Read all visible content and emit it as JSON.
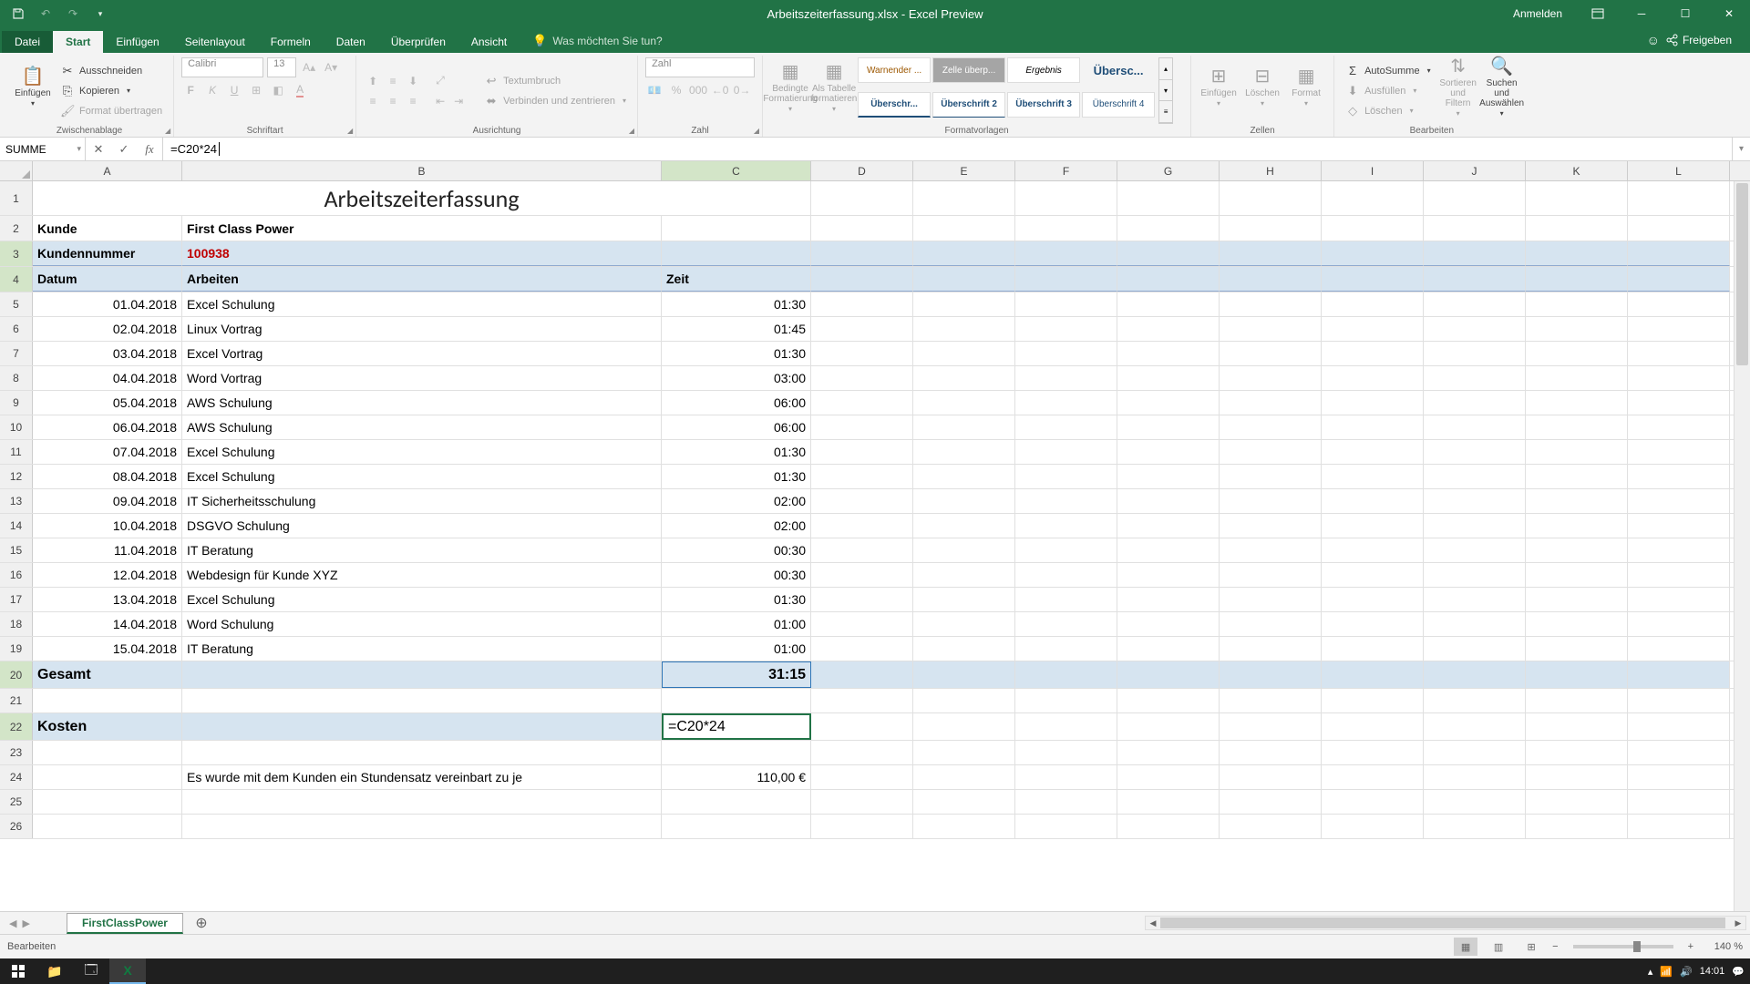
{
  "titlebar": {
    "title": "Arbeitszeiterfassung.xlsx - Excel Preview",
    "signin": "Anmelden"
  },
  "tabs": {
    "file": "Datei",
    "home": "Start",
    "insert": "Einfügen",
    "pagelayout": "Seitenlayout",
    "formulas": "Formeln",
    "data": "Daten",
    "review": "Überprüfen",
    "view": "Ansicht",
    "tellme": "Was möchten Sie tun?",
    "share": "Freigeben"
  },
  "ribbon": {
    "clipboard": {
      "label": "Zwischenablage",
      "paste": "Einfügen",
      "cut": "Ausschneiden",
      "copy": "Kopieren",
      "format_painter": "Format übertragen"
    },
    "font": {
      "label": "Schriftart",
      "name": "Calibri",
      "size": "13"
    },
    "alignment": {
      "label": "Ausrichtung",
      "wrap": "Textumbruch",
      "merge": "Verbinden und zentrieren"
    },
    "number": {
      "label": "Zahl",
      "format": "Zahl"
    },
    "styles": {
      "label": "Formatvorlagen",
      "conditional": "Bedingte Formatierung",
      "as_table": "Als Tabelle formatieren",
      "gallery": [
        "Warnender ...",
        "Zelle überp...",
        "Ergebnis",
        "Übersc...",
        "Überschr...",
        "Überschrift 2",
        "Überschrift 3",
        "Überschrift 4"
      ]
    },
    "cells": {
      "label": "Zellen",
      "insert": "Einfügen",
      "delete": "Löschen",
      "format": "Format"
    },
    "editing": {
      "label": "Bearbeiten",
      "autosum": "AutoSumme",
      "fill": "Ausfüllen",
      "clear": "Löschen",
      "sort": "Sortieren und Filtern",
      "find": "Suchen und Auswählen"
    }
  },
  "formula_bar": {
    "name_box": "SUMME",
    "formula": "=C20*24"
  },
  "columns": [
    "A",
    "B",
    "C",
    "D",
    "E",
    "F",
    "G",
    "H",
    "I",
    "J",
    "K",
    "L"
  ],
  "sheet": {
    "title": "Arbeitszeiterfassung",
    "labels": {
      "kunde": "Kunde",
      "kunde_val": "First Class Power",
      "kundennr": "Kundennummer",
      "kundennr_val": "100938",
      "datum": "Datum",
      "arbeiten": "Arbeiten",
      "zeit": "Zeit",
      "gesamt": "Gesamt",
      "gesamt_val": "31:15",
      "kosten": "Kosten",
      "kosten_formula": "=C20*24",
      "rate_text": "Es wurde mit dem Kunden ein Stundensatz vereinbart zu je",
      "rate_val": "110,00 €"
    },
    "rows": [
      {
        "n": 5,
        "date": "01.04.2018",
        "work": "Excel Schulung",
        "time": "01:30"
      },
      {
        "n": 6,
        "date": "02.04.2018",
        "work": "Linux Vortrag",
        "time": "01:45"
      },
      {
        "n": 7,
        "date": "03.04.2018",
        "work": "Excel Vortrag",
        "time": "01:30"
      },
      {
        "n": 8,
        "date": "04.04.2018",
        "work": "Word Vortrag",
        "time": "03:00"
      },
      {
        "n": 9,
        "date": "05.04.2018",
        "work": "AWS Schulung",
        "time": "06:00"
      },
      {
        "n": 10,
        "date": "06.04.2018",
        "work": "AWS Schulung",
        "time": "06:00"
      },
      {
        "n": 11,
        "date": "07.04.2018",
        "work": "Excel Schulung",
        "time": "01:30"
      },
      {
        "n": 12,
        "date": "08.04.2018",
        "work": "Excel Schulung",
        "time": "01:30"
      },
      {
        "n": 13,
        "date": "09.04.2018",
        "work": "IT Sicherheitsschulung",
        "time": "02:00"
      },
      {
        "n": 14,
        "date": "10.04.2018",
        "work": "DSGVO Schulung",
        "time": "02:00"
      },
      {
        "n": 15,
        "date": "11.04.2018",
        "work": "IT Beratung",
        "time": "00:30"
      },
      {
        "n": 16,
        "date": "12.04.2018",
        "work": "Webdesign für Kunde XYZ",
        "time": "00:30"
      },
      {
        "n": 17,
        "date": "13.04.2018",
        "work": "Excel Schulung",
        "time": "01:30"
      },
      {
        "n": 18,
        "date": "14.04.2018",
        "work": "Word Schulung",
        "time": "01:00"
      },
      {
        "n": 19,
        "date": "15.04.2018",
        "work": "IT Beratung",
        "time": "01:00"
      }
    ]
  },
  "sheet_tabs": {
    "active": "FirstClassPower"
  },
  "status": {
    "mode": "Bearbeiten",
    "zoom": "140 %"
  },
  "taskbar": {
    "time": "14:01"
  }
}
